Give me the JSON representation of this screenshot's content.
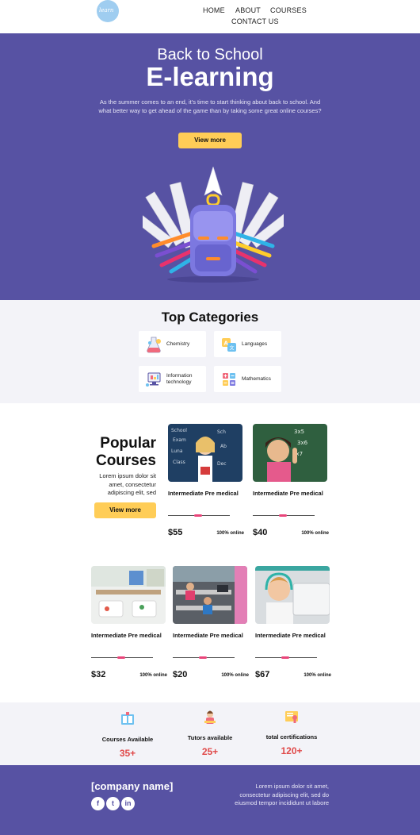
{
  "nav": {
    "logo_text": "learn",
    "items": [
      "HOME",
      "ABOUT",
      "COURSES",
      "CONTACT US"
    ]
  },
  "hero": {
    "subtitle": "Back to School",
    "title": "E-learning",
    "text": "As the summer comes to an end, it's time to start thinking about back to school. And what better way to get ahead of the game than by taking some great online courses?",
    "button": "View more"
  },
  "categories": {
    "title": "Top Categories",
    "items": [
      {
        "label": "Chemistry",
        "icon": "flask-icon"
      },
      {
        "label": "Languages",
        "icon": "translate-icon"
      },
      {
        "label": "Information technology",
        "icon": "computer-icon"
      },
      {
        "label": "Mathematics",
        "icon": "math-icon"
      }
    ]
  },
  "popular": {
    "title": "Popular Courses",
    "text": "Lorem ipsum dolor sit amet, consectetur adipiscing elit, sed",
    "button": "View more",
    "courses": [
      {
        "title": "Intermediate Pre medical",
        "price": "$55",
        "mode": "100% online"
      },
      {
        "title": "Intermediate Pre medical",
        "price": "$40",
        "mode": "100% online"
      },
      {
        "title": "Intermediate Pre medical",
        "price": "$32",
        "mode": "100% online"
      },
      {
        "title": "Intermediate Pre medical",
        "price": "$20",
        "mode": "100% online"
      },
      {
        "title": "Intermediate Pre medical",
        "price": "$67",
        "mode": "100% online"
      }
    ]
  },
  "stats": [
    {
      "label": "Courses Available",
      "value": "35+",
      "icon": "book-icon"
    },
    {
      "label": "Tutors available",
      "value": "25+",
      "icon": "tutor-icon"
    },
    {
      "label": "total certifications",
      "value": "120+",
      "icon": "certificate-icon"
    }
  ],
  "footer": {
    "company": "[company name]",
    "text": "Lorem ipsum dolor sit amet, consectetur adipiscing elit, sed do eiusmod tempor incididunt ut labore",
    "social": [
      "facebook-icon",
      "twitter-icon",
      "linkedin-icon"
    ]
  },
  "colors": {
    "brand": "#5752a3",
    "accent": "#ffcd57",
    "price_highlight": "#e04a4a"
  }
}
